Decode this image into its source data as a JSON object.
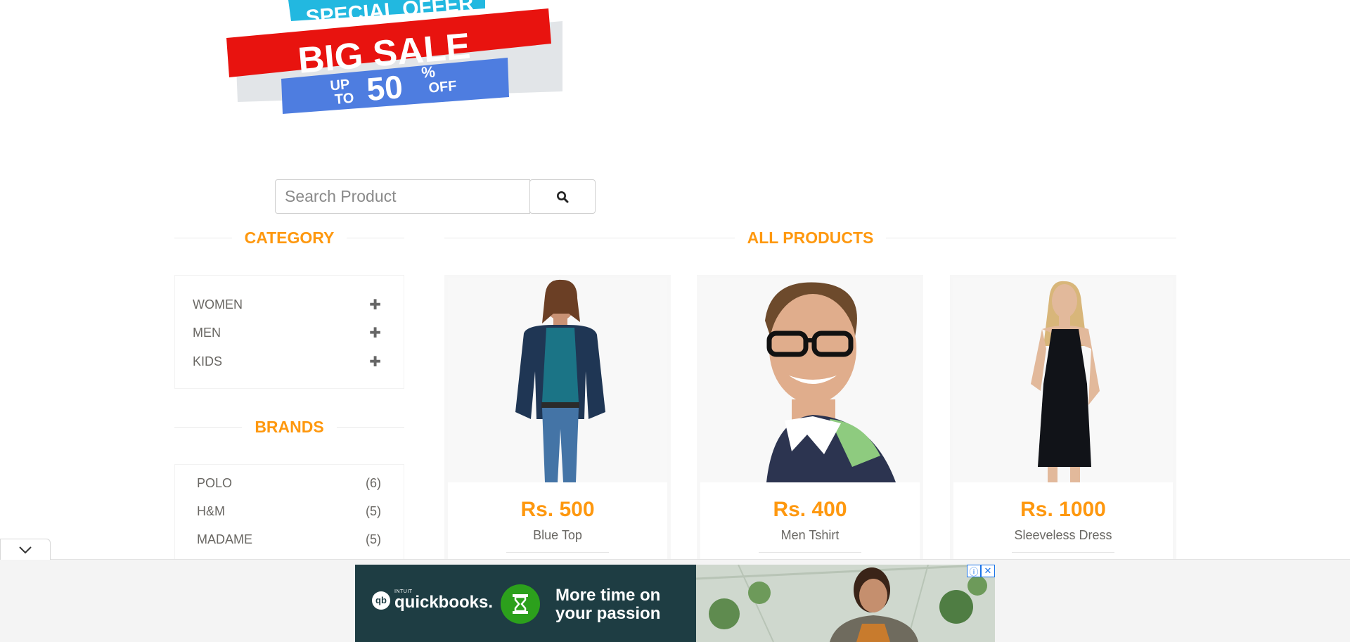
{
  "banner": {
    "line1": "SPECIAL OFFER",
    "line2": "BIG SALE",
    "line3_prefix_top": "UP",
    "line3_prefix_bottom": "TO",
    "line3_number": "50",
    "line3_percent": "%",
    "line3_suffix": "OFF"
  },
  "search": {
    "placeholder": "Search Product"
  },
  "sidebar": {
    "category_title": "CATEGORY",
    "categories": [
      {
        "label": "WOMEN"
      },
      {
        "label": "MEN"
      },
      {
        "label": "KIDS"
      }
    ],
    "brands_title": "BRANDS",
    "brands": [
      {
        "label": "POLO",
        "count": "(6)"
      },
      {
        "label": "H&M",
        "count": "(5)"
      },
      {
        "label": "MADAME",
        "count": "(5)"
      }
    ]
  },
  "products": {
    "title": "ALL PRODUCTS",
    "items": [
      {
        "price": "Rs. 500",
        "name": "Blue Top"
      },
      {
        "price": "Rs. 400",
        "name": "Men Tshirt"
      },
      {
        "price": "Rs. 1000",
        "name": "Sleeveless Dress"
      }
    ]
  },
  "ad": {
    "brand_small": "INTUIT",
    "brand": "quickbooks.",
    "headline": "More time on your passion"
  },
  "colors": {
    "accent": "#fe980f",
    "text": "#696763"
  }
}
